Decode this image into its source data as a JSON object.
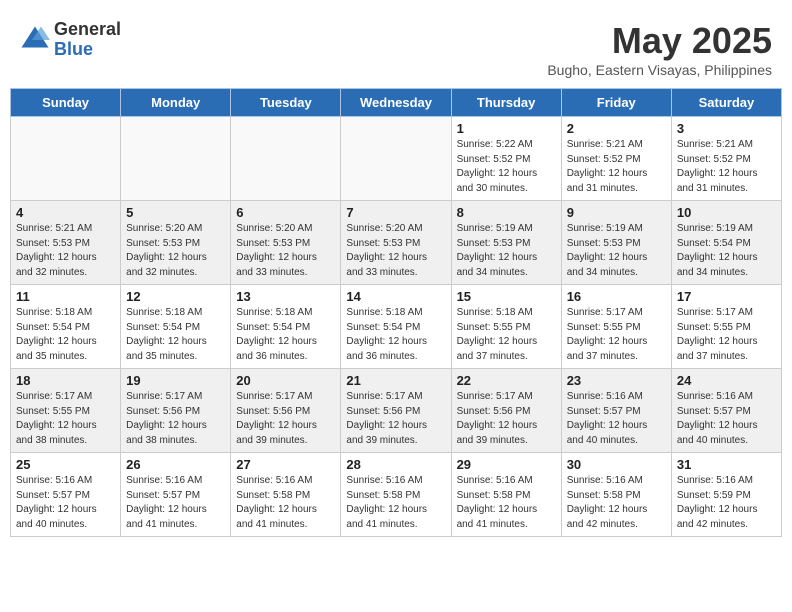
{
  "header": {
    "logo_general": "General",
    "logo_blue": "Blue",
    "month_title": "May 2025",
    "subtitle": "Bugho, Eastern Visayas, Philippines"
  },
  "days_of_week": [
    "Sunday",
    "Monday",
    "Tuesday",
    "Wednesday",
    "Thursday",
    "Friday",
    "Saturday"
  ],
  "weeks": [
    [
      {
        "day": "",
        "info": ""
      },
      {
        "day": "",
        "info": ""
      },
      {
        "day": "",
        "info": ""
      },
      {
        "day": "",
        "info": ""
      },
      {
        "day": "1",
        "info": "Sunrise: 5:22 AM\nSunset: 5:52 PM\nDaylight: 12 hours and 30 minutes."
      },
      {
        "day": "2",
        "info": "Sunrise: 5:21 AM\nSunset: 5:52 PM\nDaylight: 12 hours and 31 minutes."
      },
      {
        "day": "3",
        "info": "Sunrise: 5:21 AM\nSunset: 5:52 PM\nDaylight: 12 hours and 31 minutes."
      }
    ],
    [
      {
        "day": "4",
        "info": "Sunrise: 5:21 AM\nSunset: 5:53 PM\nDaylight: 12 hours and 32 minutes."
      },
      {
        "day": "5",
        "info": "Sunrise: 5:20 AM\nSunset: 5:53 PM\nDaylight: 12 hours and 32 minutes."
      },
      {
        "day": "6",
        "info": "Sunrise: 5:20 AM\nSunset: 5:53 PM\nDaylight: 12 hours and 33 minutes."
      },
      {
        "day": "7",
        "info": "Sunrise: 5:20 AM\nSunset: 5:53 PM\nDaylight: 12 hours and 33 minutes."
      },
      {
        "day": "8",
        "info": "Sunrise: 5:19 AM\nSunset: 5:53 PM\nDaylight: 12 hours and 34 minutes."
      },
      {
        "day": "9",
        "info": "Sunrise: 5:19 AM\nSunset: 5:53 PM\nDaylight: 12 hours and 34 minutes."
      },
      {
        "day": "10",
        "info": "Sunrise: 5:19 AM\nSunset: 5:54 PM\nDaylight: 12 hours and 34 minutes."
      }
    ],
    [
      {
        "day": "11",
        "info": "Sunrise: 5:18 AM\nSunset: 5:54 PM\nDaylight: 12 hours and 35 minutes."
      },
      {
        "day": "12",
        "info": "Sunrise: 5:18 AM\nSunset: 5:54 PM\nDaylight: 12 hours and 35 minutes."
      },
      {
        "day": "13",
        "info": "Sunrise: 5:18 AM\nSunset: 5:54 PM\nDaylight: 12 hours and 36 minutes."
      },
      {
        "day": "14",
        "info": "Sunrise: 5:18 AM\nSunset: 5:54 PM\nDaylight: 12 hours and 36 minutes."
      },
      {
        "day": "15",
        "info": "Sunrise: 5:18 AM\nSunset: 5:55 PM\nDaylight: 12 hours and 37 minutes."
      },
      {
        "day": "16",
        "info": "Sunrise: 5:17 AM\nSunset: 5:55 PM\nDaylight: 12 hours and 37 minutes."
      },
      {
        "day": "17",
        "info": "Sunrise: 5:17 AM\nSunset: 5:55 PM\nDaylight: 12 hours and 37 minutes."
      }
    ],
    [
      {
        "day": "18",
        "info": "Sunrise: 5:17 AM\nSunset: 5:55 PM\nDaylight: 12 hours and 38 minutes."
      },
      {
        "day": "19",
        "info": "Sunrise: 5:17 AM\nSunset: 5:56 PM\nDaylight: 12 hours and 38 minutes."
      },
      {
        "day": "20",
        "info": "Sunrise: 5:17 AM\nSunset: 5:56 PM\nDaylight: 12 hours and 39 minutes."
      },
      {
        "day": "21",
        "info": "Sunrise: 5:17 AM\nSunset: 5:56 PM\nDaylight: 12 hours and 39 minutes."
      },
      {
        "day": "22",
        "info": "Sunrise: 5:17 AM\nSunset: 5:56 PM\nDaylight: 12 hours and 39 minutes."
      },
      {
        "day": "23",
        "info": "Sunrise: 5:16 AM\nSunset: 5:57 PM\nDaylight: 12 hours and 40 minutes."
      },
      {
        "day": "24",
        "info": "Sunrise: 5:16 AM\nSunset: 5:57 PM\nDaylight: 12 hours and 40 minutes."
      }
    ],
    [
      {
        "day": "25",
        "info": "Sunrise: 5:16 AM\nSunset: 5:57 PM\nDaylight: 12 hours and 40 minutes."
      },
      {
        "day": "26",
        "info": "Sunrise: 5:16 AM\nSunset: 5:57 PM\nDaylight: 12 hours and 41 minutes."
      },
      {
        "day": "27",
        "info": "Sunrise: 5:16 AM\nSunset: 5:58 PM\nDaylight: 12 hours and 41 minutes."
      },
      {
        "day": "28",
        "info": "Sunrise: 5:16 AM\nSunset: 5:58 PM\nDaylight: 12 hours and 41 minutes."
      },
      {
        "day": "29",
        "info": "Sunrise: 5:16 AM\nSunset: 5:58 PM\nDaylight: 12 hours and 41 minutes."
      },
      {
        "day": "30",
        "info": "Sunrise: 5:16 AM\nSunset: 5:58 PM\nDaylight: 12 hours and 42 minutes."
      },
      {
        "day": "31",
        "info": "Sunrise: 5:16 AM\nSunset: 5:59 PM\nDaylight: 12 hours and 42 minutes."
      }
    ]
  ]
}
